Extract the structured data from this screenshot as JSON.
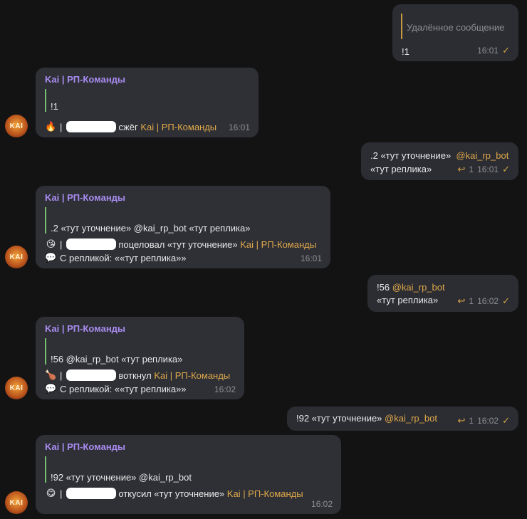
{
  "bot_name": "Kai | РП-Команды",
  "avatar_text": "KAI",
  "messages": [
    {
      "quote": "Удалённое сообщение",
      "text": "!1",
      "time": "16:01"
    },
    {
      "quote": "!1",
      "action": "сжёг",
      "time": "16:01",
      "emoji": "🔥"
    },
    {
      "line1_a": ".2 «тут уточнение»",
      "line1_b": "@kai_rp_bot",
      "line2": "«тут реплика»",
      "replies": "1",
      "time": "16:01"
    },
    {
      "quote": ".2 «тут уточнение»  @kai_rp_bot  «тут реплика»",
      "action": "поцеловал «тут уточнение»",
      "reply_text": "С репликой: ««тут реплика»»",
      "time": "16:01",
      "emoji": "😘",
      "emoji2": "💬"
    },
    {
      "line1_a": "!56",
      "line1_b": "@kai_rp_bot",
      "line2": "«тут реплика»",
      "replies": "1",
      "time": "16:02"
    },
    {
      "quote": "!56 @kai_rp_bot  «тут реплика»",
      "action": "воткнул",
      "reply_text": "С репликой: ««тут реплика»»",
      "time": "16:02",
      "emoji": "🍗",
      "emoji2": "💬"
    },
    {
      "line1_a": "!92 «тут уточнение»",
      "line1_b": "@kai_rp_bot",
      "replies": "1",
      "time": "16:02"
    },
    {
      "quote": "!92 «тут уточнение» @kai_rp_bot",
      "action": "откусил «тут уточнение»",
      "time": "16:02",
      "emoji": "😋"
    }
  ],
  "icons": {
    "check": "check-icon",
    "reply": "reply-icon"
  }
}
